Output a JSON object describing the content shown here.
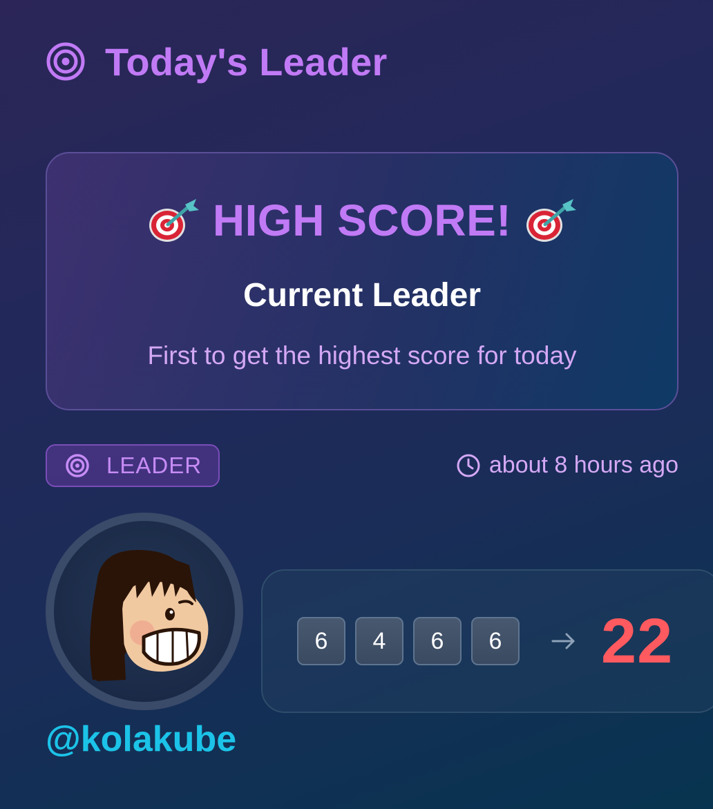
{
  "header": {
    "title": "Today's Leader",
    "icon": "target-icon",
    "accent_color": "#c17af5"
  },
  "banner": {
    "heading": "HIGH SCORE!",
    "heading_icon": "dart-bullseye-icon",
    "subtitle": "Current Leader",
    "description": "First to get the highest score for today"
  },
  "badge": {
    "label": "LEADER",
    "icon": "target-icon"
  },
  "timestamp": {
    "text": "about 8 hours ago",
    "icon": "clock-icon"
  },
  "user": {
    "username": "@kolakube",
    "username_color": "#1cc3e8",
    "avatar": "avatar"
  },
  "score": {
    "dice": [
      "6",
      "4",
      "6",
      "6"
    ],
    "arrow_icon": "arrow-right-icon",
    "total": "22",
    "total_color": "#ff5a5f"
  }
}
